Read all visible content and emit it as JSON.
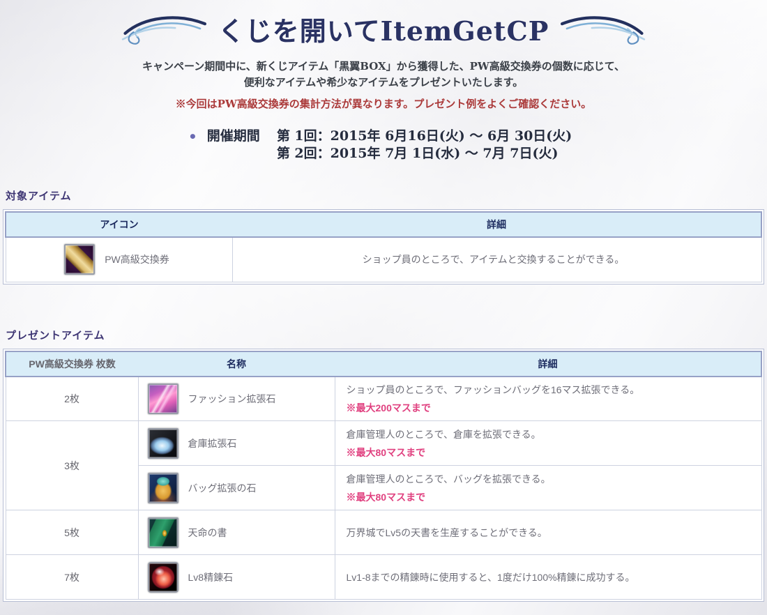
{
  "title": "くじを開いてItemGetCP",
  "intro": {
    "line1": "キャンペーン期間中に、新くじアイテム「黒翼BOX」から獲得した、PW高級交換券の個数に応じて、",
    "line2": "便利なアイテムや希少なアイテムをプレゼントいたします。",
    "warning": "※今回はPW高級交換券の集計方法が異なります。プレゼント例をよくご確認ください。"
  },
  "schedule": {
    "bullet": "•",
    "label": "開催期間",
    "round1": "第 1回：2015年 6月16日(火) ～ 6月 30日(火)",
    "round2": "第 2回：2015年 7月 1日(水) ～ 7月 7日(火)"
  },
  "target_section": {
    "heading": "対象アイテム",
    "headers": {
      "icon": "アイコン",
      "detail": "詳細"
    },
    "row": {
      "name": "PW高級交換券",
      "detail": "ショップ員のところで、アイテムと交換することができる。"
    }
  },
  "present": {
    "heading": "プレゼントアイテム",
    "headers": {
      "count": "PW高級交換券 枚数",
      "name": "名称",
      "detail": "詳細"
    },
    "rows": [
      {
        "count": "2枚",
        "name": "ファッション拡張石",
        "detail": "ショップ員のところで、ファッションバッグを16マス拡張できる。",
        "note": "※最大200マスまで"
      },
      {
        "count": "3枚",
        "name": "倉庫拡張石",
        "detail": "倉庫管理人のところで、倉庫を拡張できる。",
        "note": "※最大80マスまで"
      },
      {
        "name": "バッグ拡張の石",
        "detail": "倉庫管理人のところで、バッグを拡張できる。",
        "note": "※最大80マスまで"
      },
      {
        "count": "5枚",
        "name": "天命の書",
        "detail": "万界城でLv5の天書を生産することができる。",
        "note": ""
      },
      {
        "count": "7枚",
        "name": "Lv8精錬石",
        "detail": "Lv1-8までの精錬時に使用すると、1度だけ100%精錬に成功する。",
        "note": ""
      }
    ]
  },
  "colors": {
    "title_navy": "#2a3263",
    "heading_purple": "#3e3674",
    "warning_red": "#ab3a3a",
    "note_pink": "#e0407f",
    "table_header_bg": "#d9edf8",
    "table_header_text": "#1b2a5e",
    "table_border": "#97a1c6"
  }
}
